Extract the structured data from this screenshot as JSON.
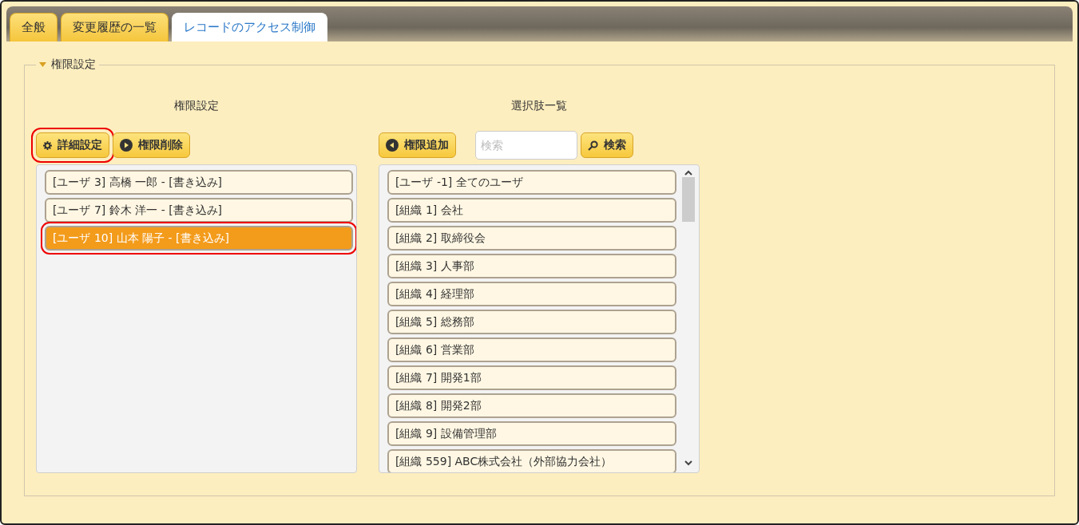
{
  "tabs": [
    {
      "label": "全般",
      "selected": false
    },
    {
      "label": "変更履歴の一覧",
      "selected": false
    },
    {
      "label": "レコードのアクセス制御",
      "selected": true
    }
  ],
  "section": {
    "title": "権限設定",
    "expanded": true
  },
  "permissions": {
    "heading": "権限設定",
    "buttons": [
      {
        "label": "詳細設定",
        "kind": "gear",
        "callout": true
      },
      {
        "label": "権限削除",
        "kind": "right",
        "callout": false
      }
    ],
    "items": [
      {
        "label": "[ユーザ 3] 高橋 一郎 - [書き込み]",
        "selected": false,
        "callout": false
      },
      {
        "label": "[ユーザ 7] 鈴木 洋一 - [書き込み]",
        "selected": false,
        "callout": false
      },
      {
        "label": "[ユーザ 10] 山本 陽子 - [書き込み]",
        "selected": true,
        "callout": true
      }
    ]
  },
  "choices": {
    "heading": "選択肢一覧",
    "add_button": {
      "label": "権限追加"
    },
    "search": {
      "placeholder": "検索"
    },
    "search_button": {
      "label": "検索"
    },
    "items": [
      {
        "label": "[ユーザ -1] 全てのユーザ"
      },
      {
        "label": "[組織 1] 会社"
      },
      {
        "label": "[組織 2] 取締役会"
      },
      {
        "label": "[組織 3] 人事部"
      },
      {
        "label": "[組織 4] 経理部"
      },
      {
        "label": "[組織 5] 総務部"
      },
      {
        "label": "[組織 6] 営業部"
      },
      {
        "label": "[組織 7] 開発1部"
      },
      {
        "label": "[組織 8] 開発2部"
      },
      {
        "label": "[組織 9] 設備管理部"
      },
      {
        "label": "[組織 559] ABC株式会社（外部協力会社）"
      }
    ]
  }
}
